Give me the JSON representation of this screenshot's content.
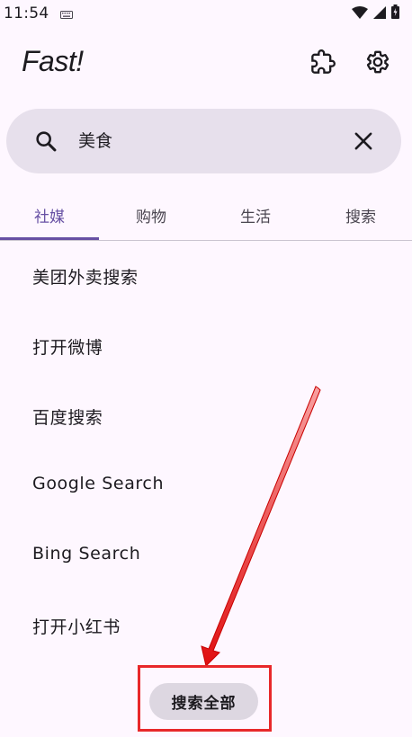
{
  "status_bar": {
    "time": "11:54"
  },
  "app": {
    "title": "Fast!"
  },
  "search": {
    "value": "美食"
  },
  "tabs": [
    {
      "label": "社媒",
      "active": true
    },
    {
      "label": "购物",
      "active": false
    },
    {
      "label": "生活",
      "active": false
    },
    {
      "label": "搜索",
      "active": false
    }
  ],
  "list": {
    "items": [
      {
        "label": "美团外卖搜索"
      },
      {
        "label": "打开微博"
      },
      {
        "label": "百度搜索"
      },
      {
        "label": "Google Search"
      },
      {
        "label": "Bing Search"
      },
      {
        "label": "打开小红书"
      }
    ]
  },
  "fab": {
    "label": "搜索全部"
  },
  "colors": {
    "background": "#FEF7FF",
    "accent": "#6750A4",
    "search_bg": "#E7E0EC",
    "annotation": "#E8282A"
  },
  "icons": {
    "keyboard": "keyboard-icon",
    "wifi": "wifi-icon",
    "signal": "signal-icon",
    "battery": "battery-charging-icon",
    "extension": "extension-puzzle-icon",
    "settings": "gear-icon",
    "search": "search-icon",
    "clear": "close-icon"
  }
}
